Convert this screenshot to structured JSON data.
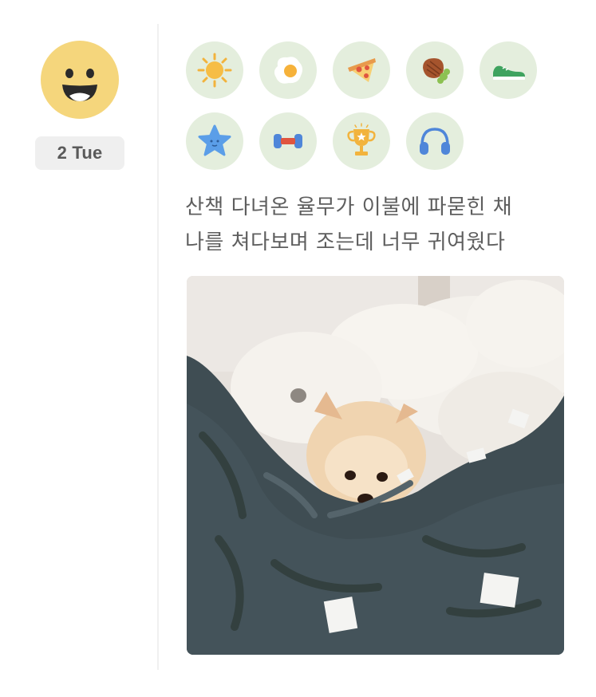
{
  "entry": {
    "mood_icon": "grinning-face-icon",
    "mood_color": "#f5d67c",
    "date_label": "2 Tue"
  },
  "activities": [
    {
      "icon": "sun-icon"
    },
    {
      "icon": "fried-egg-icon"
    },
    {
      "icon": "pizza-slice-icon"
    },
    {
      "icon": "steak-icon"
    },
    {
      "icon": "sneaker-icon"
    },
    {
      "icon": "star-icon"
    },
    {
      "icon": "dumbbell-icon"
    },
    {
      "icon": "trophy-icon"
    },
    {
      "icon": "headphones-icon"
    }
  ],
  "activity_bg_color": "#e4eedd",
  "note": {
    "text": "산책 다녀온 율무가 이불에 파묻힌 채\n나를 쳐다보며 조는데 너무 귀여웠다"
  },
  "photo": {
    "subject": "pomeranian-dog-under-blanket-photo"
  }
}
